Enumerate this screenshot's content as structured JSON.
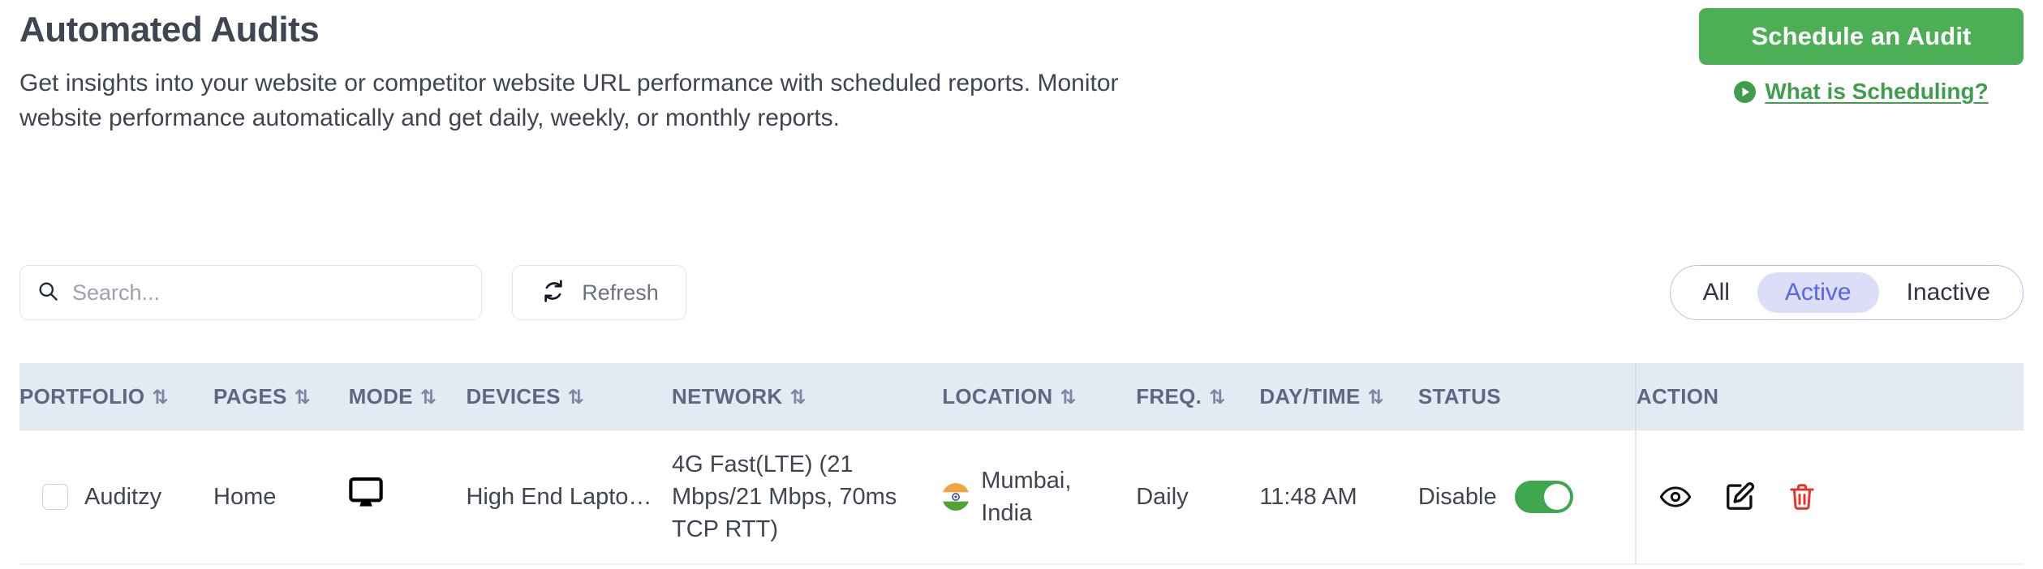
{
  "header": {
    "title": "Automated Audits",
    "subtitle": "Get insights into your website or competitor website URL performance with scheduled reports. Monitor website performance automatically and get daily, weekly, or monthly reports.",
    "schedule_button": "Schedule an Audit",
    "scheduling_link": "What is Scheduling?",
    "accent_green": "#4CAF55",
    "link_green": "#3F9E4D"
  },
  "toolbar": {
    "search_placeholder": "Search...",
    "search_value": "",
    "refresh_label": "Refresh",
    "filters": [
      {
        "label": "All",
        "active": false
      },
      {
        "label": "Active",
        "active": true
      },
      {
        "label": "Inactive",
        "active": false
      }
    ],
    "active_filter_bg": "#DCDEF8",
    "active_filter_color": "#5865E8"
  },
  "table": {
    "header_bg": "#E4EAF4",
    "columns": [
      {
        "label": "PORTFOLIO",
        "sortable": true
      },
      {
        "label": "PAGES",
        "sortable": true
      },
      {
        "label": "MODE",
        "sortable": true
      },
      {
        "label": "DEVICES",
        "sortable": true
      },
      {
        "label": "NETWORK",
        "sortable": true
      },
      {
        "label": "LOCATION",
        "sortable": true
      },
      {
        "label": "FREQ.",
        "sortable": true
      },
      {
        "label": "DAY/TIME",
        "sortable": true
      },
      {
        "label": "STATUS",
        "sortable": false
      },
      {
        "label": "ACTION",
        "sortable": false
      }
    ],
    "sort_glyph": "⇅",
    "rows": [
      {
        "selected": false,
        "portfolio": "Auditzy",
        "pages": "Home",
        "mode_icon": "desktop-monitor-icon",
        "devices": "High End Lapto…",
        "network": "4G Fast(LTE) (21 Mbps/21 Mbps, 70ms TCP RTT)",
        "location": "Mumbai, India",
        "location_flag": "flag-india-icon",
        "freq": "Daily",
        "daytime": "11:48 AM",
        "status_label": "Disable",
        "status_on": true,
        "status_toggle_color": "#3FA84F",
        "actions": [
          {
            "name": "view-icon",
            "color": "#111111"
          },
          {
            "name": "edit-icon",
            "color": "#111111"
          },
          {
            "name": "delete-icon",
            "color": "#E8332A"
          }
        ]
      }
    ]
  }
}
